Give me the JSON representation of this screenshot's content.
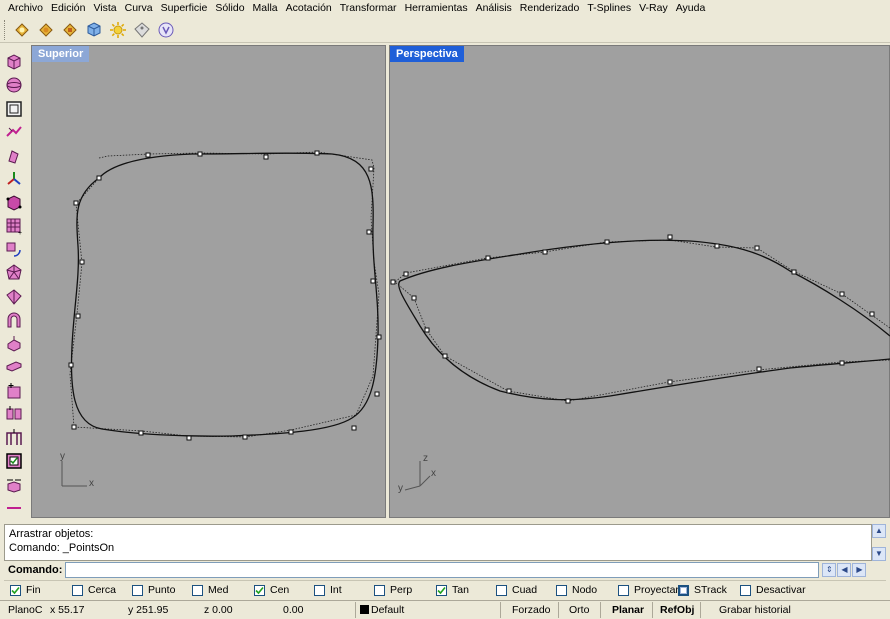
{
  "menubar": {
    "items": [
      "Archivo",
      "Edición",
      "Vista",
      "Curva",
      "Superficie",
      "Sólido",
      "Malla",
      "Acotación",
      "Transformar",
      "Herramientas",
      "Análisis",
      "Renderizado",
      "T-Splines",
      "V-Ray",
      "Ayuda"
    ]
  },
  "toolbar": {
    "icons": [
      "vray-lightbulb-icon",
      "vray-lightbulb-icon",
      "vray-lightbulb-icon",
      "cube-icon",
      "sun-icon",
      "tag-icon",
      "vray-logo-icon"
    ]
  },
  "left_toolbar": {
    "icons": [
      "box-icon",
      "sphere-icon",
      "wireframe-box-icon",
      "pick-icon",
      "rotate-view-icon",
      "axes-icon",
      "solid-box-icon",
      "grid-points-icon",
      "transform-icon",
      "polyhedron-icon",
      "surface-icon",
      "arch-icon",
      "extrude-icon",
      "slab-icon",
      "box-add-icon",
      "array-icon",
      "column-icon",
      "checkbox-tool-icon",
      "flip-icon",
      "more-icon"
    ]
  },
  "viewports": {
    "top": {
      "title": "Superior",
      "axis_x": "x",
      "axis_y": "y"
    },
    "perspective": {
      "title": "Perspectiva",
      "axis_x": "x",
      "axis_y": "y",
      "axis_z": "z"
    }
  },
  "command": {
    "history": [
      "Arrastrar objetos:",
      "Comando: _PointsOn"
    ],
    "label": "Comando:",
    "value": ""
  },
  "osnap": {
    "items": [
      {
        "label": "Fin",
        "checked": true
      },
      {
        "label": "Cerca",
        "checked": false
      },
      {
        "label": "Punto",
        "checked": false
      },
      {
        "label": "Med",
        "checked": false
      },
      {
        "label": "Cen",
        "checked": true
      },
      {
        "label": "Int",
        "checked": false
      },
      {
        "label": "Perp",
        "checked": false
      },
      {
        "label": "Tan",
        "checked": true
      },
      {
        "label": "Cuad",
        "checked": false
      },
      {
        "label": "Nodo",
        "checked": false
      },
      {
        "label": "Proyectar",
        "checked": false
      },
      {
        "label": "STrack",
        "checked": "filled"
      },
      {
        "label": "Desactivar",
        "checked": false
      }
    ]
  },
  "status": {
    "plane": "PlanoC",
    "x": "x 55.17",
    "y": "y 251.95",
    "z": "z 0.00",
    "distance": "0.00",
    "layer": "Default",
    "forzado": "Forzado",
    "orto": "Orto",
    "planar": "Planar",
    "refobj": "RefObj",
    "history": "Grabar historial"
  },
  "colors": {
    "viewport_bg": "#a0a0a0",
    "active_title": "#1f5fd8",
    "inactive_title": "#8ca7d6",
    "chrome": "#ece9d8"
  }
}
